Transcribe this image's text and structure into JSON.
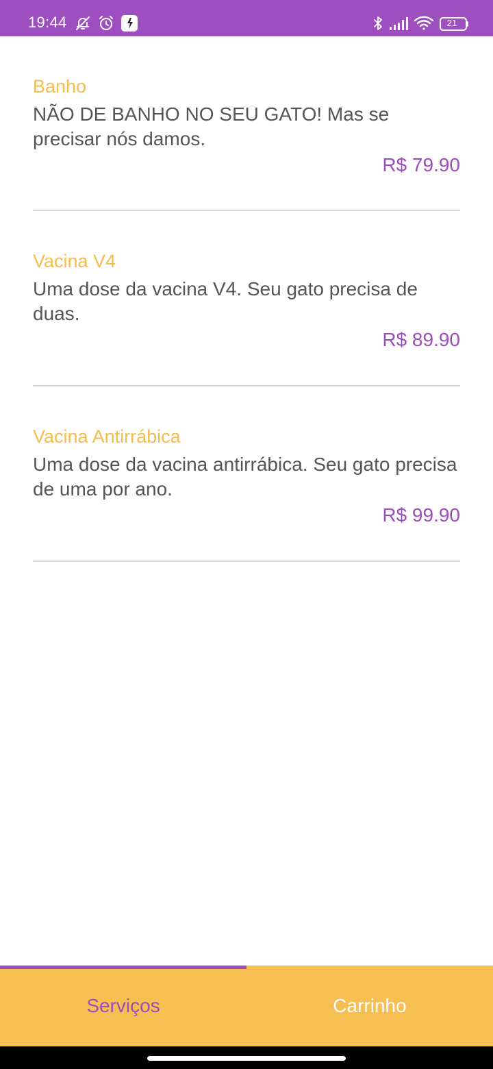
{
  "status_bar": {
    "time": "19:44",
    "battery_level": "21",
    "background_color": "#9e4fbf",
    "left_icons": [
      "notifications-muted-icon",
      "alarm-icon",
      "app-notification-icon"
    ],
    "right_icons": [
      "bluetooth-icon",
      "signal-icon",
      "wifi-icon",
      "battery-icon"
    ]
  },
  "services": [
    {
      "name": "Banho",
      "description": "NÃO DE BANHO NO SEU GATO! Mas se precisar nós damos.",
      "price": "R$ 79.90"
    },
    {
      "name": "Vacina V4",
      "description": "Uma dose da vacina V4. Seu gato precisa de duas.",
      "price": "R$ 89.90"
    },
    {
      "name": "Vacina Antirrábica",
      "description": "Uma dose da vacina antirrábica. Seu gato precisa de uma por ano.",
      "price": "R$ 99.90"
    }
  ],
  "bottom_nav": {
    "tabs": [
      {
        "label": "Serviços",
        "selected": true
      },
      {
        "label": "Carrinho",
        "selected": false
      }
    ],
    "background_color": "#f7bf52",
    "accent_color": "#9c4dbb"
  },
  "colors": {
    "title": "#f4bd4d",
    "description": "#555555",
    "price": "#9c4dbb",
    "divider": "#d6d6d6"
  }
}
